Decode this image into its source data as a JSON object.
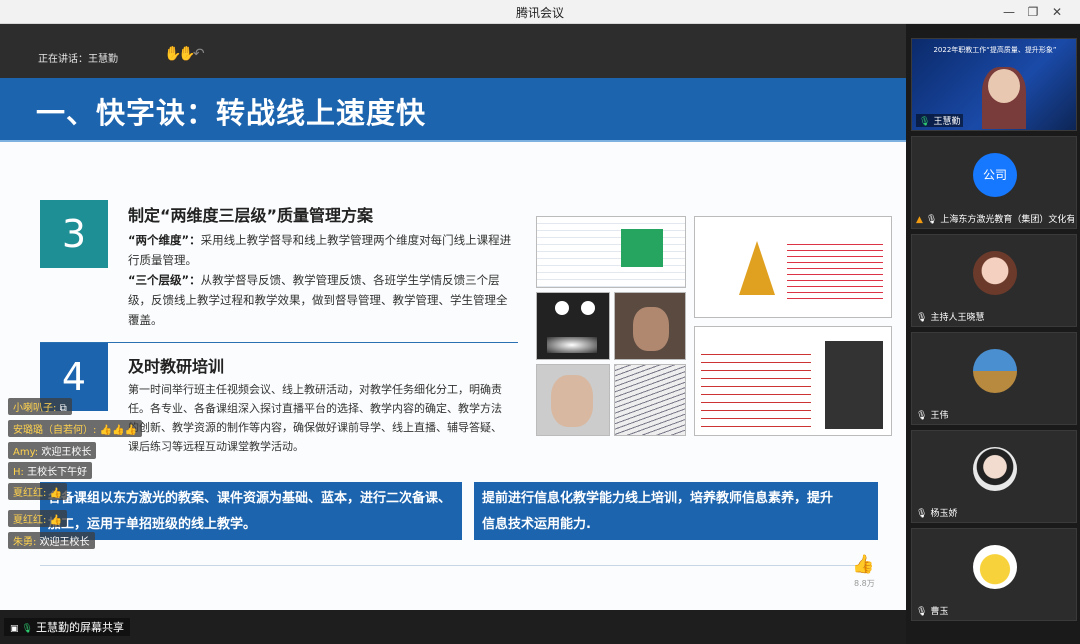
{
  "window": {
    "title": "腾讯会议",
    "min": "—",
    "restore": "❐",
    "max": "□",
    "close": "✕"
  },
  "share": {
    "speaking": "正在讲话：王慧勤",
    "label": "王慧勤的屏幕共享",
    "like_count": "8.8万"
  },
  "slide": {
    "title": "一、快字诀：转战线上速度快",
    "sec3": {
      "num": "3",
      "title": "制定“两维度三层级”质量管理方案",
      "p1_head": "“两个维度”：",
      "p1": "采用线上教学督导和线上教学管理两个维度对每门线上课程进行质量管理。",
      "p2_head": "“三个层级”：",
      "p2": "从教学督导反馈、教学管理反馈、各班学生学情反馈三个层级，反馈线上教学过程和教学效果，做到督导管理、教学管理、学生管理全覆盖。"
    },
    "sec4": {
      "num": "4",
      "title": "及时教研培训",
      "body": "第一时间举行班主任视频会议、线上教研活动，对教学任务细化分工，明确责任。各专业、各备课组深入探讨直播平台的选择、教学内容的确定、教学方法的创新、教学资源的制作等内容，确保做好课前导学、线上直播、辅导答疑、课后练习等远程互动课堂教学活动。"
    },
    "banner_left": "各备课组以东方激光的教案、课件资源为基础、蓝本，进行二次备课、加工，运用于单招班级的线上教学。",
    "banner_right": "提前进行信息化教学能力线上培训，培养教师信息素养，提升信息技术运用能力."
  },
  "chat": [
    {
      "name": "小喇叭子:",
      "msg": ""
    },
    {
      "name": "安璐璐（自若何）:",
      "msg": "👍👍👍"
    },
    {
      "name": "Amy:",
      "msg": "欢迎王校长"
    },
    {
      "name": "H:",
      "msg": "王校长下午好"
    },
    {
      "name": "夏红红:",
      "msg": "👍"
    },
    {
      "name": "夏红红:",
      "msg": "👍"
    },
    {
      "name": "朱勇:",
      "msg": "欢迎王校长"
    }
  ],
  "participants": [
    {
      "name": "王慧勤",
      "type": "video"
    },
    {
      "name": "上海东方激光教育（集团）文化有...",
      "type": "text",
      "avatar_text": "公司"
    },
    {
      "name": "主持人王晓慧",
      "type": "avatar"
    },
    {
      "name": "王伟",
      "type": "avatar"
    },
    {
      "name": "杨玉娇",
      "type": "avatar"
    },
    {
      "name": "曹玉",
      "type": "avatar"
    }
  ],
  "tile0_banner": "2022年职教工作“提高质量、提升形象”",
  "colors": {
    "accent": "#1c64ae",
    "teal": "#1f8f96",
    "company_avatar": "#1677ff"
  }
}
